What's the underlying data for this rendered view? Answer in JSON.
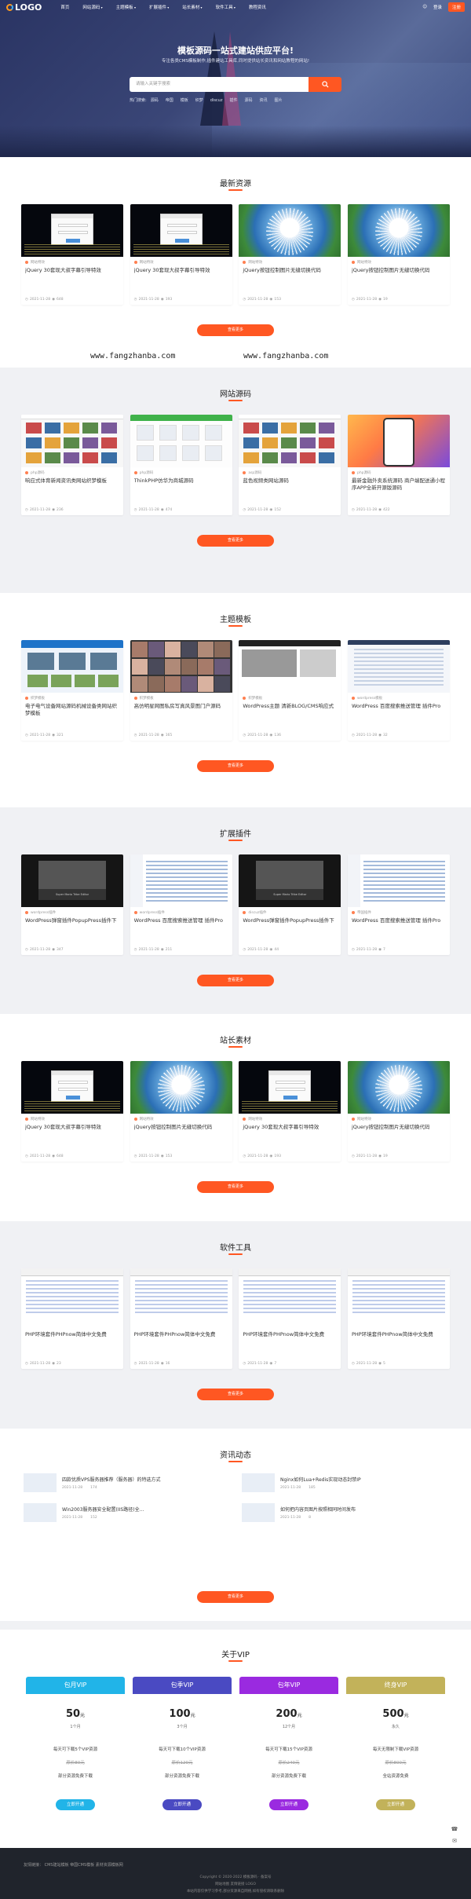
{
  "header": {
    "logo_text": "LOGO",
    "nav": [
      "首页",
      "网站源码",
      "主题模板",
      "扩展插件",
      "站长素材",
      "软件工具",
      "教程资讯"
    ],
    "nav_dropdown": [
      false,
      true,
      true,
      true,
      true,
      true,
      false
    ],
    "login": "登录",
    "register": "注册"
  },
  "hero": {
    "title": "模板源码一站式建站供应平台!",
    "subtitle": "专注各类CMS模板制作,插件建站工具库,同时提供站长资讯和网站教程的网站!",
    "search_placeholder": "请输入关键字搜索",
    "hot_label": "热门搜索:",
    "hot_words": [
      "源码",
      "帝国",
      "模板",
      "织梦",
      "discuz",
      "插件",
      "源码",
      "资讯",
      "图片"
    ]
  },
  "accent": "#ff5722",
  "sections": [
    {
      "title": "最新资源",
      "more": "查看更多",
      "cards": [
        {
          "cat": "网站特效",
          "title": "jQuery 30套现大叔字幕引导特效",
          "date": "2021-11-28",
          "views": "648",
          "thumb": "js"
        },
        {
          "cat": "网站特效",
          "title": "jQuery 30套现大叔字幕引导特效",
          "date": "2021-11-28",
          "views": "193",
          "thumb": "js"
        },
        {
          "cat": "网站特效",
          "title": "jQuery按钮控制图片无缝切换代码",
          "date": "2021-11-28",
          "views": "153",
          "thumb": "dand"
        },
        {
          "cat": "网站特效",
          "title": "jQuery按钮控制图片无缝切换代码",
          "date": "2021-11-28",
          "views": "19",
          "thumb": "dand"
        }
      ]
    },
    {
      "title": "网站源码",
      "more": "查看更多",
      "cards": [
        {
          "cat": "php源码",
          "title": "响应式体育新闻资讯类网站织梦模板",
          "date": "2021-11-28",
          "views": "236",
          "thumb": "web"
        },
        {
          "cat": "php源码",
          "title": "ThinkPHP仿华为商城源码",
          "date": "2021-11-28",
          "views": "474",
          "thumb": "shop"
        },
        {
          "cat": "asp源码",
          "title": "蓝色视频类网站源码",
          "date": "2021-11-28",
          "views": "152",
          "thumb": "web"
        },
        {
          "cat": "php源码",
          "title": "最新金融外卖系统源码 商户端配送通小程序APP全新开源版源码",
          "date": "2021-11-28",
          "views": "422",
          "thumb": "app"
        }
      ]
    },
    {
      "title": "主题模板",
      "more": "查看更多",
      "cards": [
        {
          "cat": "织梦模板",
          "title": "电子电气设备网站源码机械设备类网站织梦模板",
          "date": "2021-11-28",
          "views": "321",
          "thumb": "tpl1"
        },
        {
          "cat": "织梦模板",
          "title": "高仿明星网图私房写真风景图门户源码",
          "date": "2021-11-28",
          "views": "165",
          "thumb": "tpl2"
        },
        {
          "cat": "织梦模板",
          "title": "WordPress主题 清新BLOG/CMS响应式",
          "date": "2021-11-28",
          "views": "136",
          "thumb": "tpl3"
        },
        {
          "cat": "wordpress模板",
          "title": "WordPress 百度搜索推送管理 插件Pro",
          "date": "2021-11-28",
          "views": "32",
          "thumb": "tpl4"
        }
      ]
    },
    {
      "title": "扩展插件",
      "more": "查看更多",
      "cards": [
        {
          "cat": "wordpress插件",
          "title": "WordPress弹窗插件PopupPress插件下",
          "date": "2021-11-28",
          "views": "347",
          "thumb": "pop"
        },
        {
          "cat": "wordpress插件",
          "title": "WordPress 百度搜索推送管理 插件Pro",
          "date": "2021-11-28",
          "views": "211",
          "thumb": "admin"
        },
        {
          "cat": "discuz插件",
          "title": "WordPress弹窗插件PopupPress插件下",
          "date": "2021-11-28",
          "views": "44",
          "thumb": "pop"
        },
        {
          "cat": "帝国插件",
          "title": "WordPress 百度搜索推送管理 插件Pro",
          "date": "2021-11-28",
          "views": "7",
          "thumb": "admin"
        }
      ]
    },
    {
      "title": "站长素材",
      "more": "查看更多",
      "cards": [
        {
          "cat": "网站特效",
          "title": "jQuery 30套现大叔字幕引导特效",
          "date": "2021-11-28",
          "views": "648",
          "thumb": "js"
        },
        {
          "cat": "网站特效",
          "title": "jQuery按钮控制图片无缝切换代码",
          "date": "2021-11-28",
          "views": "153",
          "thumb": "dand"
        },
        {
          "cat": "网站特效",
          "title": "jQuery 30套现大叔字幕引导特效",
          "date": "2021-11-28",
          "views": "193",
          "thumb": "js"
        },
        {
          "cat": "网站特效",
          "title": "jQuery按钮控制图片无缝切换代码",
          "date": "2021-11-28",
          "views": "19",
          "thumb": "dand"
        }
      ]
    },
    {
      "title": "软件工具",
      "more": "查看更多",
      "cards": [
        {
          "cat": "",
          "title": "PHP环境套件PHPnow简体中文免费",
          "date": "2021-11-28",
          "views": "23",
          "thumb": "php"
        },
        {
          "cat": "",
          "title": "PHP环境套件PHPnow简体中文免费",
          "date": "2021-11-28",
          "views": "16",
          "thumb": "php"
        },
        {
          "cat": "",
          "title": "PHP环境套件PHPnow简体中文免费",
          "date": "2021-11-28",
          "views": "7",
          "thumb": "php"
        },
        {
          "cat": "",
          "title": "PHP环境套件PHPnow简体中文免费",
          "date": "2021-11-28",
          "views": "5",
          "thumb": "php"
        }
      ]
    }
  ],
  "watermark": [
    "www.fangzhanba.com",
    "www.fangzhanba.com"
  ],
  "news": {
    "title": "资讯动态",
    "more": "查看更多",
    "items": [
      {
        "title": "四款优质VPS服务器推荐（服务器）的特选方式",
        "date": "2021-11-28",
        "views": "174"
      },
      {
        "title": "Nginx如何Lua+Redis实现动态封禁IP",
        "date": "2021-11-28",
        "views": "185"
      },
      {
        "title": "Win2003服务器安全配置(IIS路径)全...",
        "date": "2021-11-28",
        "views": "152"
      },
      {
        "title": "如何把内容页图片按照相同时间发布",
        "date": "2021-11-28",
        "views": "8"
      }
    ]
  },
  "vip": {
    "title": "关于VIP",
    "plans": [
      {
        "name": "包月VIP",
        "price": "50",
        "unit": "元",
        "period": "1个月",
        "l1": "每天可下载5个VIP资源",
        "l2": "原价80元",
        "l3": "部分资源免费下载",
        "btn": "立即开通",
        "color": "#21b4e8"
      },
      {
        "name": "包季VIP",
        "price": "100",
        "unit": "元",
        "period": "3个月",
        "l1": "每天可下载10个VIP资源",
        "l2": "原价120元",
        "l3": "部分资源免费下载",
        "btn": "立即开通",
        "color": "#4a4ac2"
      },
      {
        "name": "包年VIP",
        "price": "200",
        "unit": "元",
        "period": "12个月",
        "l1": "每天可下载15个VIP资源",
        "l2": "原价240元",
        "l3": "部分资源免费下载",
        "btn": "立即开通",
        "color": "#9a2ae0"
      },
      {
        "name": "终身VIP",
        "price": "500",
        "unit": "元",
        "period": "永久",
        "l1": "每天无限制下载VIP资源",
        "l2": "原价800元",
        "l3": "全站资源免费",
        "btn": "立即开通",
        "color": "#c2b25a"
      }
    ]
  },
  "footer": {
    "links": "友情链接：  CMS建站模板  帝国CMS模板  素材资源模板网",
    "copyright": "Copyright © 2020-2022 模板源码 · 备案号",
    "line2": "网站地图  友情链接  LOGO",
    "line3": "本站内容仅供学习参考,部分资源来自网络,如有侵权请联系删除"
  }
}
